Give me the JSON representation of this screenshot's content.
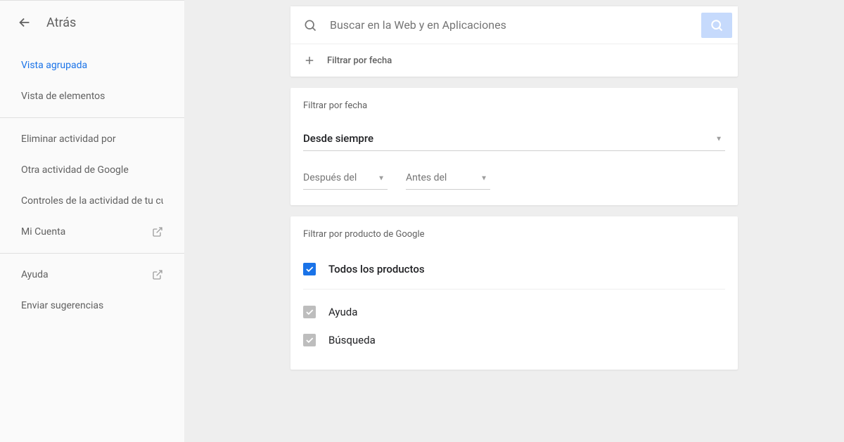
{
  "sidebar": {
    "back_label": "Atrás",
    "section1": [
      {
        "label": "Vista agrupada",
        "active": true
      },
      {
        "label": "Vista de elementos",
        "active": false
      }
    ],
    "section2": [
      {
        "label": "Eliminar actividad por",
        "ext": false
      },
      {
        "label": "Otra actividad de Google",
        "ext": false
      },
      {
        "label": "Controles de la actividad de tu cuenta",
        "ext": false
      },
      {
        "label": "Mi Cuenta",
        "ext": true
      }
    ],
    "section3": [
      {
        "label": "Ayuda",
        "ext": true
      },
      {
        "label": "Enviar sugerencias",
        "ext": false
      }
    ]
  },
  "search": {
    "placeholder": "Buscar en la Web y en Aplicaciones",
    "filter_label": "Filtrar por fecha"
  },
  "date_card": {
    "title": "Filtrar por fecha",
    "range_label": "Desde siempre",
    "after_label": "Después del",
    "before_label": "Antes del"
  },
  "product_card": {
    "title": "Filtrar por producto de Google",
    "all_label": "Todos los productos",
    "items": [
      {
        "label": "Ayuda"
      },
      {
        "label": "Búsqueda"
      }
    ]
  }
}
